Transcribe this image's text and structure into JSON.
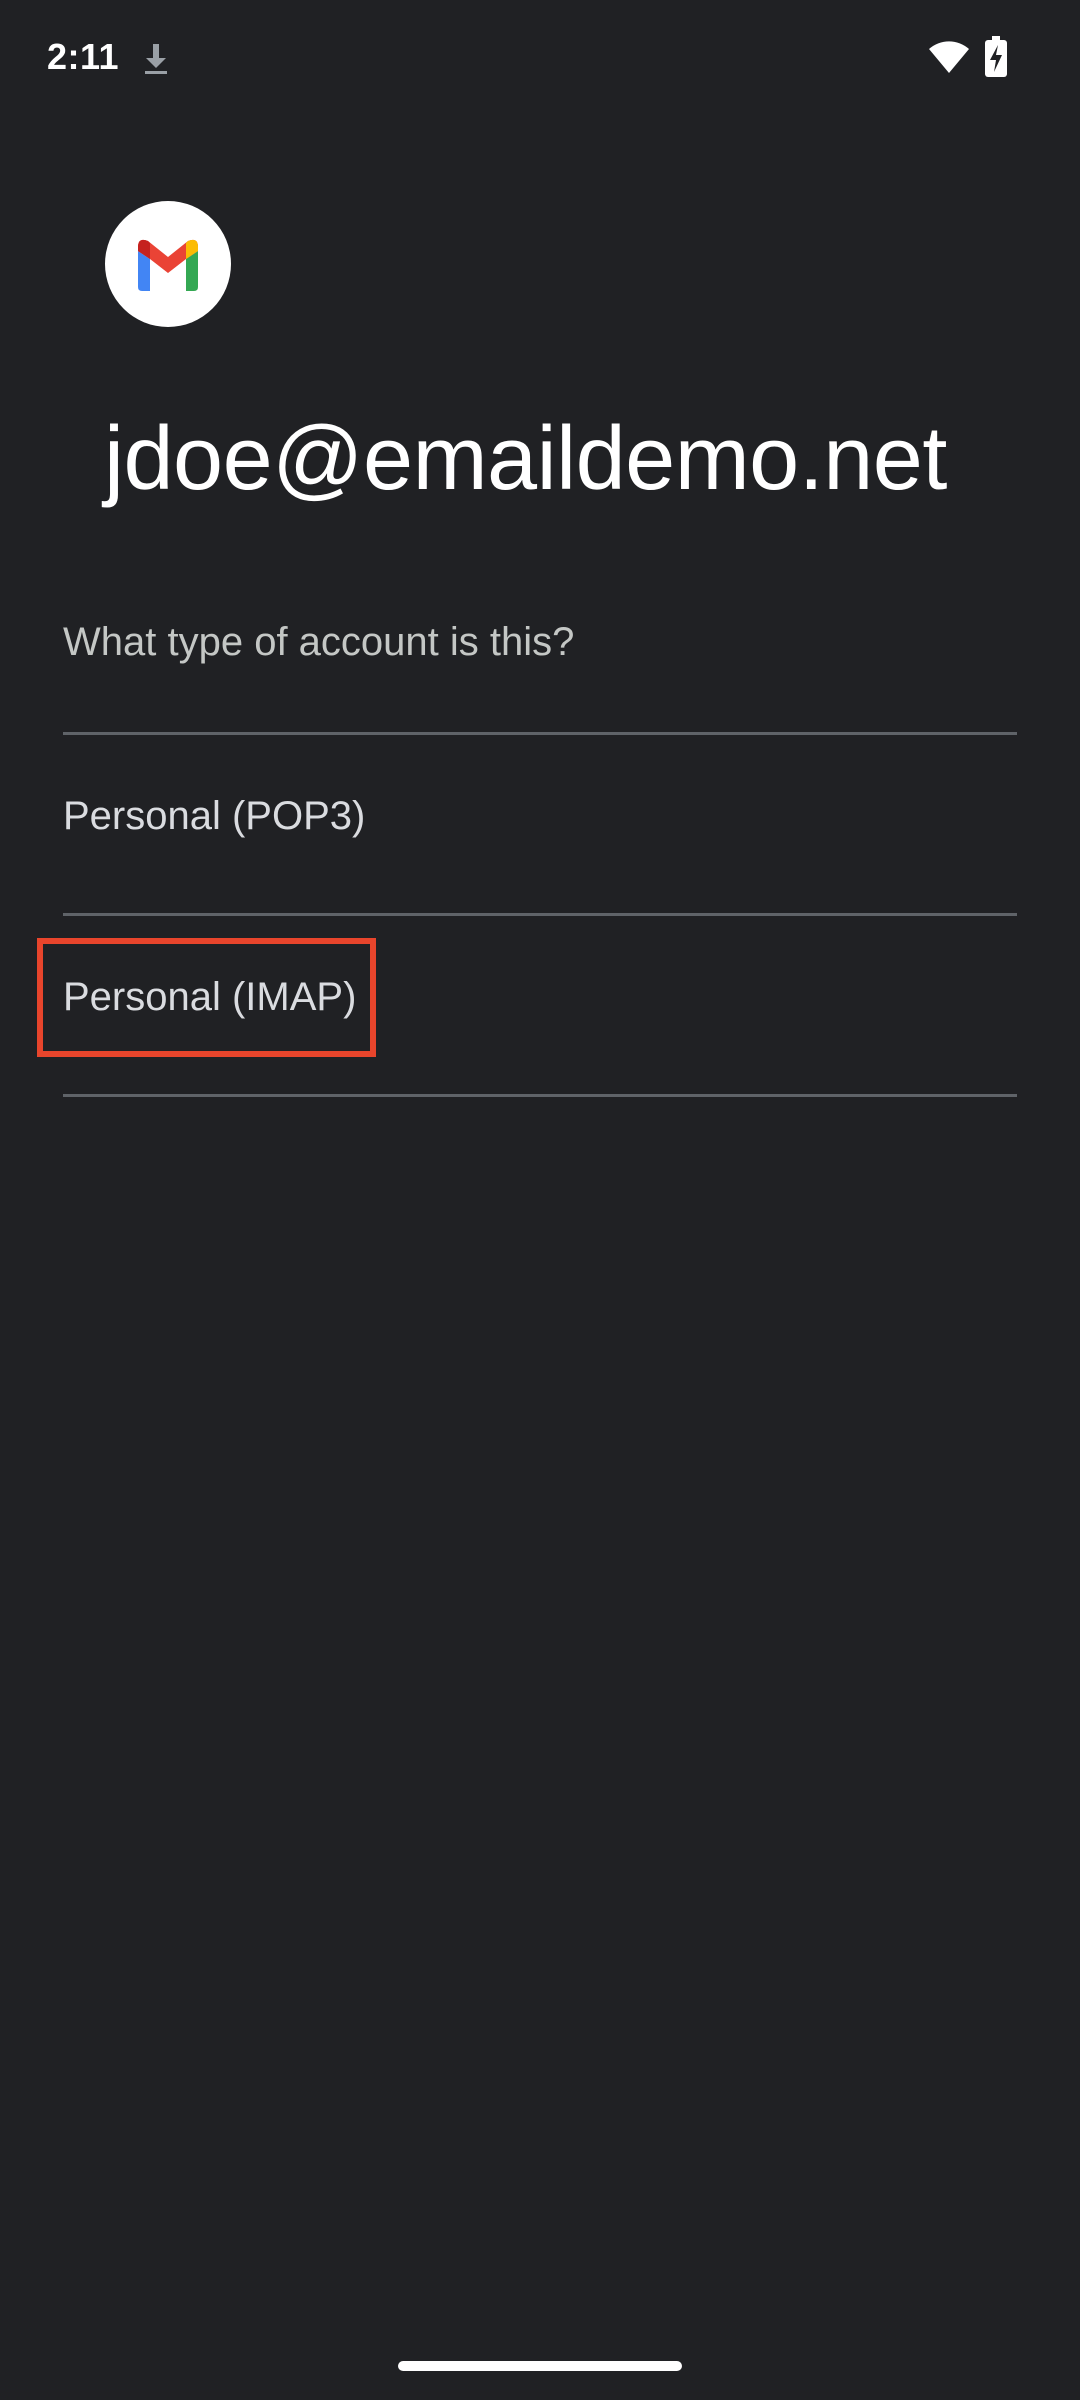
{
  "status_bar": {
    "time": "2:11",
    "icons": [
      "download-icon",
      "wifi-icon",
      "battery-charging-icon"
    ]
  },
  "app": {
    "logo_icon": "gmail-logo-icon",
    "brand_colors": {
      "red": "#EA4335",
      "blue": "#4285F4",
      "green": "#34A853",
      "yellow": "#FBBC04"
    }
  },
  "account": {
    "email": "jdoe@emaildemo.net"
  },
  "prompt": {
    "question": "What type of account is this?"
  },
  "options": [
    {
      "label": "Personal (POP3)"
    },
    {
      "label": "Personal (IMAP)",
      "highlighted": true
    }
  ],
  "highlight_color": "#E8452C"
}
